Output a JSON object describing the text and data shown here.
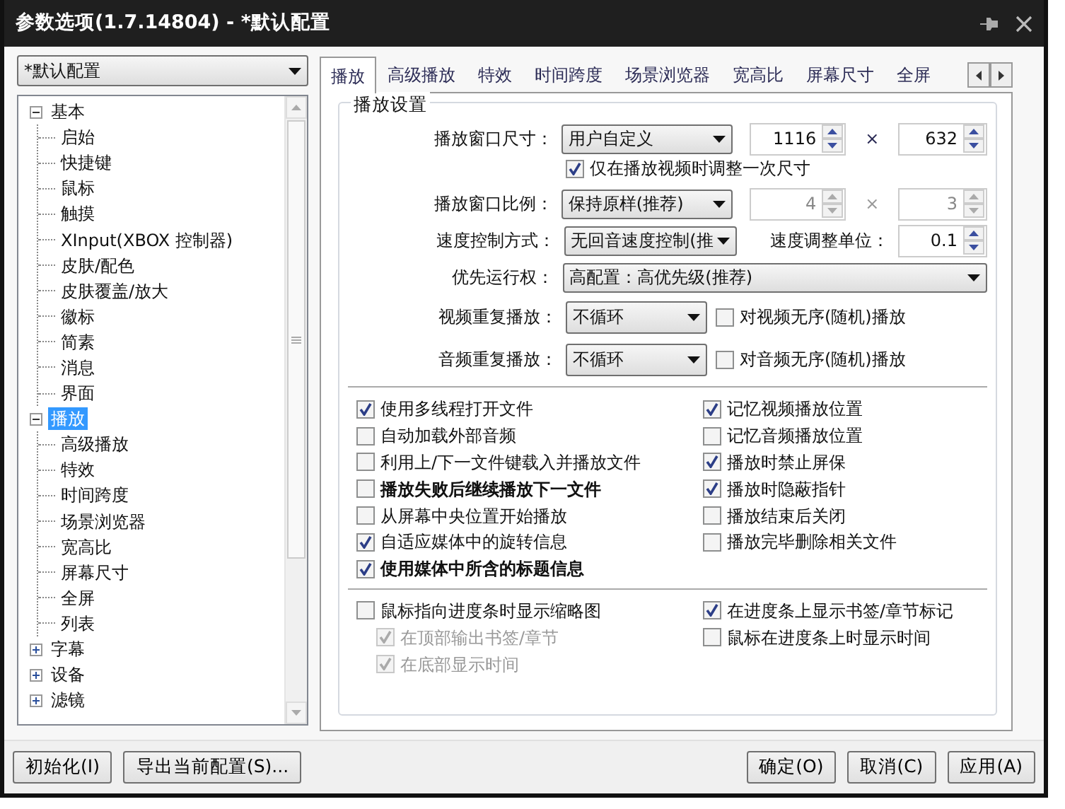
{
  "window": {
    "title": "参数选项(1.7.14804) - *默认配置"
  },
  "profile": {
    "value": "*默认配置"
  },
  "tree": [
    {
      "label": "基本",
      "selected": false,
      "expanded": true,
      "children": [
        {
          "label": "启始",
          "selected": false
        },
        {
          "label": "快捷键",
          "selected": false
        },
        {
          "label": "鼠标",
          "selected": false
        },
        {
          "label": "触摸",
          "selected": false
        },
        {
          "label": "XInput(XBOX 控制器)",
          "selected": false
        },
        {
          "label": "皮肤/配色",
          "selected": false
        },
        {
          "label": "皮肤覆盖/放大",
          "selected": false
        },
        {
          "label": "徽标",
          "selected": false
        },
        {
          "label": "简素",
          "selected": false
        },
        {
          "label": "消息",
          "selected": false
        },
        {
          "label": "界面",
          "selected": false
        }
      ]
    },
    {
      "label": "播放",
      "selected": true,
      "expanded": true,
      "children": [
        {
          "label": "高级播放",
          "selected": false
        },
        {
          "label": "特效",
          "selected": false
        },
        {
          "label": "时间跨度",
          "selected": false
        },
        {
          "label": "场景浏览器",
          "selected": false
        },
        {
          "label": "宽高比",
          "selected": false
        },
        {
          "label": "屏幕尺寸",
          "selected": false
        },
        {
          "label": "全屏",
          "selected": false
        },
        {
          "label": "列表",
          "selected": false
        }
      ]
    },
    {
      "label": "字幕",
      "selected": false,
      "expanded": false
    },
    {
      "label": "设备",
      "selected": false,
      "expanded": false
    },
    {
      "label": "滤镜",
      "selected": false,
      "expanded": false
    }
  ],
  "tabs": [
    {
      "label": "播放",
      "selected": true
    },
    {
      "label": "高级播放",
      "selected": false
    },
    {
      "label": "特效",
      "selected": false
    },
    {
      "label": "时间跨度",
      "selected": false
    },
    {
      "label": "场景浏览器",
      "selected": false
    },
    {
      "label": "宽高比",
      "selected": false
    },
    {
      "label": "屏幕尺寸",
      "selected": false
    },
    {
      "label": "全屏",
      "selected": false
    }
  ],
  "group": {
    "title": "播放设置"
  },
  "settings": [
    {
      "kind": "size",
      "label": "播放窗口尺寸：",
      "dropdown": "用户自定义",
      "first": "1116",
      "times": "×",
      "second": "632",
      "disabled": false
    },
    {
      "kind": "check",
      "label": "仅在播放视频时调整一次尺寸",
      "checked": true
    },
    {
      "kind": "size",
      "label": "播放窗口比例：",
      "dropdown": "保持原样(推荐)",
      "first": "4",
      "times": "×",
      "second": "3",
      "disabled": true
    },
    {
      "kind": "speed",
      "label": "速度控制方式：",
      "dropdown": "无回音速度控制(推",
      "unit_label": "速度调整单位：",
      "unit": "0.1"
    },
    {
      "kind": "wide",
      "label": "优先运行权：",
      "dropdown": "高配置：高优先级(推荐)"
    },
    {
      "kind": "repeat",
      "label": "视频重复播放：",
      "dropdown": "不循环",
      "option": "对视频无序(随机)播放",
      "checked": false
    },
    {
      "kind": "repeat",
      "label": "音频重复播放：",
      "dropdown": "不循环",
      "option": "对音频无序(随机)播放",
      "checked": false
    }
  ],
  "options": [
    {
      "left": [
        {
          "label": "使用多线程打开文件",
          "checked": true,
          "bold": false
        },
        {
          "label": "自动加载外部音频",
          "checked": false,
          "bold": false
        },
        {
          "label": "利用上/下一文件键载入并播放文件",
          "checked": false,
          "bold": false
        },
        {
          "label": "播放失败后继续播放下一文件",
          "checked": false,
          "bold": true
        },
        {
          "label": "从屏幕中央位置开始播放",
          "checked": false,
          "bold": false
        },
        {
          "label": "自适应媒体中的旋转信息",
          "checked": true,
          "bold": false
        },
        {
          "label": "使用媒体中所含的标题信息",
          "checked": true,
          "bold": true
        }
      ],
      "right": [
        {
          "label": "记忆视频播放位置",
          "checked": true,
          "bold": false
        },
        {
          "label": "记忆音频播放位置",
          "checked": false,
          "bold": false
        },
        {
          "label": "播放时禁止屏保",
          "checked": true,
          "bold": false
        },
        {
          "label": "播放时隐蔽指针",
          "checked": true,
          "bold": false
        },
        {
          "label": "播放结束后关闭",
          "checked": false,
          "bold": false
        },
        {
          "label": "播放完毕删除相关文件",
          "checked": false,
          "bold": false
        }
      ]
    },
    {
      "left": [
        {
          "label": "鼠标指向进度条时显示缩略图",
          "checked": false,
          "bold": false,
          "children": [
            {
              "label": "在顶部输出书签/章节",
              "checked": true,
              "bold": false,
              "disabled": true
            },
            {
              "label": "在底部显示时间",
              "checked": true,
              "bold": false,
              "disabled": true
            }
          ]
        }
      ],
      "right": [
        {
          "label": "在进度条上显示书签/章节标记",
          "checked": true,
          "bold": false
        },
        {
          "label": "鼠标在进度条上时显示时间",
          "checked": false,
          "bold": false
        }
      ]
    }
  ],
  "left_buttons": [
    "初始化(I)",
    "导出当前配置(S)..."
  ],
  "right_buttons": [
    "确定(O)",
    "取消(C)",
    "应用(A)"
  ]
}
